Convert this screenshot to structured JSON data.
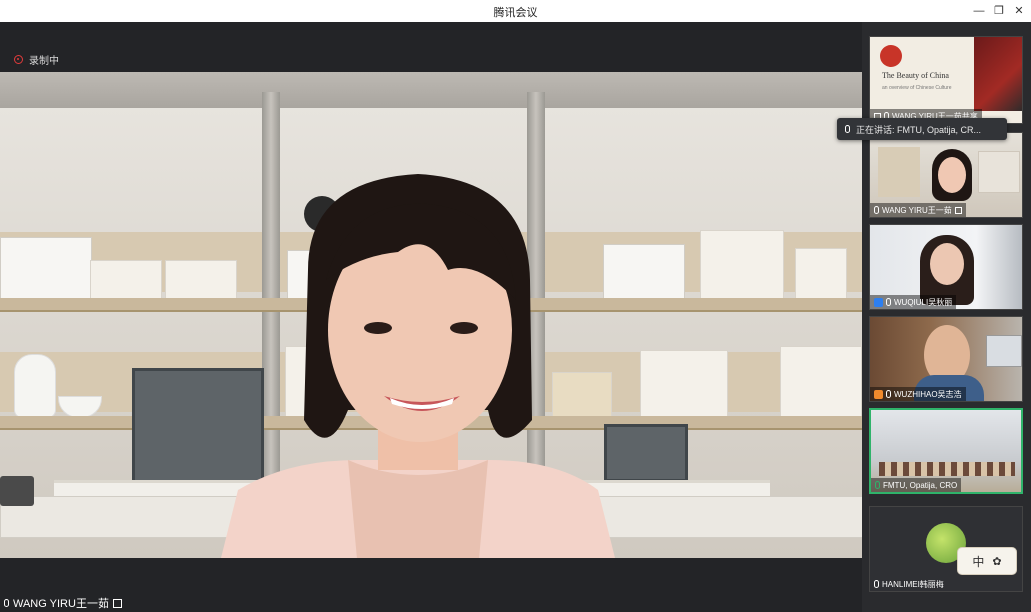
{
  "window": {
    "title": "腾讯会议"
  },
  "recording": {
    "label": "录制中"
  },
  "main_speaker": {
    "name": "WANG YIRU王一茹"
  },
  "speaking_banner": {
    "label": "正在讲话: FMTU, Opatija, CR..."
  },
  "tiles": [
    {
      "name": "WANG YIRU王一茹共享",
      "slide_title": "The Beauty of China",
      "slide_sub": "an overview of Chinese Culture"
    },
    {
      "name": "WANG YIRU王一茹"
    },
    {
      "name": "WUQIULI吴秋丽"
    },
    {
      "name": "WUZHIHAO吴志浩"
    },
    {
      "name": "FMTU, Opatija, CRO"
    },
    {
      "name": "HANLIMEI韩丽梅"
    }
  ],
  "ime": {
    "label": "中"
  },
  "colors": {
    "recording": "#e23b3b",
    "active_border": "#2fb36a"
  }
}
